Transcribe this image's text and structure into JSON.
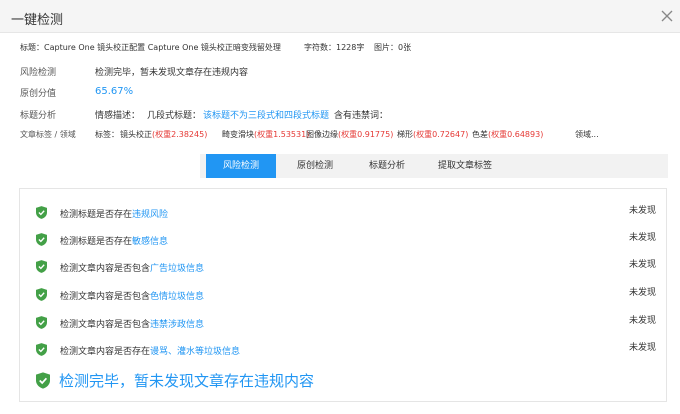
{
  "dialog": {
    "title": "一键检测",
    "close_icon": "close-icon"
  },
  "meta": {
    "title_label": "标题：",
    "title_value": "Capture One 镜头校正配置 Capture One 镜头校正暗变残留处理",
    "word_count": "字符数：1228字",
    "image_count": "图片：0张"
  },
  "risk": {
    "label": "风险检测",
    "value": "检测完毕，暂未发现文章存在违规内容"
  },
  "originality": {
    "label": "原创分值",
    "value": "65.67%"
  },
  "title_analysis": {
    "label": "标题分析",
    "emotion_label": "情感描述：",
    "segment_label": "几段式标题：",
    "segment_value": "该标题不为三段式和四段式标题",
    "sensitive_label": "含有违禁词："
  },
  "tags": {
    "label": "文章标签 / 领域",
    "tag_label": "标签：",
    "items": [
      {
        "name": "镜头校正",
        "weight": "(权重2.38245)"
      },
      {
        "name": "畸变滑块",
        "weight": "(权重1.53531)"
      },
      {
        "name": "图像边缘",
        "weight": "(权重0.91775)"
      },
      {
        "name": "梯形",
        "weight": "(权重0.72647)"
      },
      {
        "name": "色差",
        "weight": "(权重0.64893)"
      }
    ],
    "domain_label": "领域..."
  },
  "tabs": [
    {
      "label": "风险检测",
      "active": true
    },
    {
      "label": "原创检测",
      "active": false
    },
    {
      "label": "标题分析",
      "active": false
    },
    {
      "label": "提取文章标签",
      "active": false
    }
  ],
  "checks": [
    {
      "prefix": "检测标题是否存在",
      "highlight": "违规风险",
      "status": "未发现"
    },
    {
      "prefix": "检测标题是否存在",
      "highlight": "敏感信息",
      "status": "未发现"
    },
    {
      "prefix": "检测文章内容是否包含",
      "highlight": "广告垃圾信息",
      "status": "未发现"
    },
    {
      "prefix": "检测文章内容是否包含",
      "highlight": "色情垃圾信息",
      "status": "未发现"
    },
    {
      "prefix": "检测文章内容是否包含",
      "highlight": "违禁涉政信息",
      "status": "未发现"
    },
    {
      "prefix": "检测文章内容是否存在",
      "highlight": "谩骂、灌水等垃圾信息",
      "status": "未发现"
    }
  ],
  "final_message": "检测完毕，暂未发现文章存在违规内容",
  "colors": {
    "accent": "#2196f3",
    "shield": "#43a047",
    "weight": "#e53935"
  },
  "icons": {
    "shield": "shield-check-icon"
  }
}
